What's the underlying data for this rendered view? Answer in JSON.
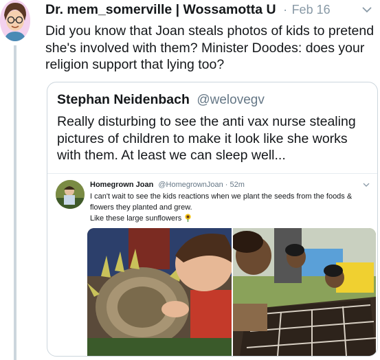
{
  "tweet": {
    "author": "Dr. mem_somerville | Wossamotta U",
    "separator": "·",
    "date": "Feb 16",
    "text": "Did you know that Joan steals photos of kids to pretend she's involved with them? Minister Doodes: does your religion support that lying too?"
  },
  "quoted": {
    "author": "Stephan Neidenbach",
    "handle": "@welovegv",
    "text": "Really disturbing to see the anti vax nurse stealing pictures of children to make it look like she works with them. At least we can sleep well..."
  },
  "inner": {
    "author": "Homegrown Joan",
    "handle": "@HomegrownJoan · 52m",
    "line1": "I can't wait to see the kids reactions when we plant the seeds from the foods &",
    "line2": "flowers they planted and grew.",
    "line3": "Like these large sunflowers"
  },
  "icons": {
    "chevron": "chevron-down-icon",
    "sunflower": "sunflower-emoji-icon"
  },
  "colors": {
    "text": "#14171a",
    "muted": "#8899a6",
    "border": "#ccd6dd"
  }
}
